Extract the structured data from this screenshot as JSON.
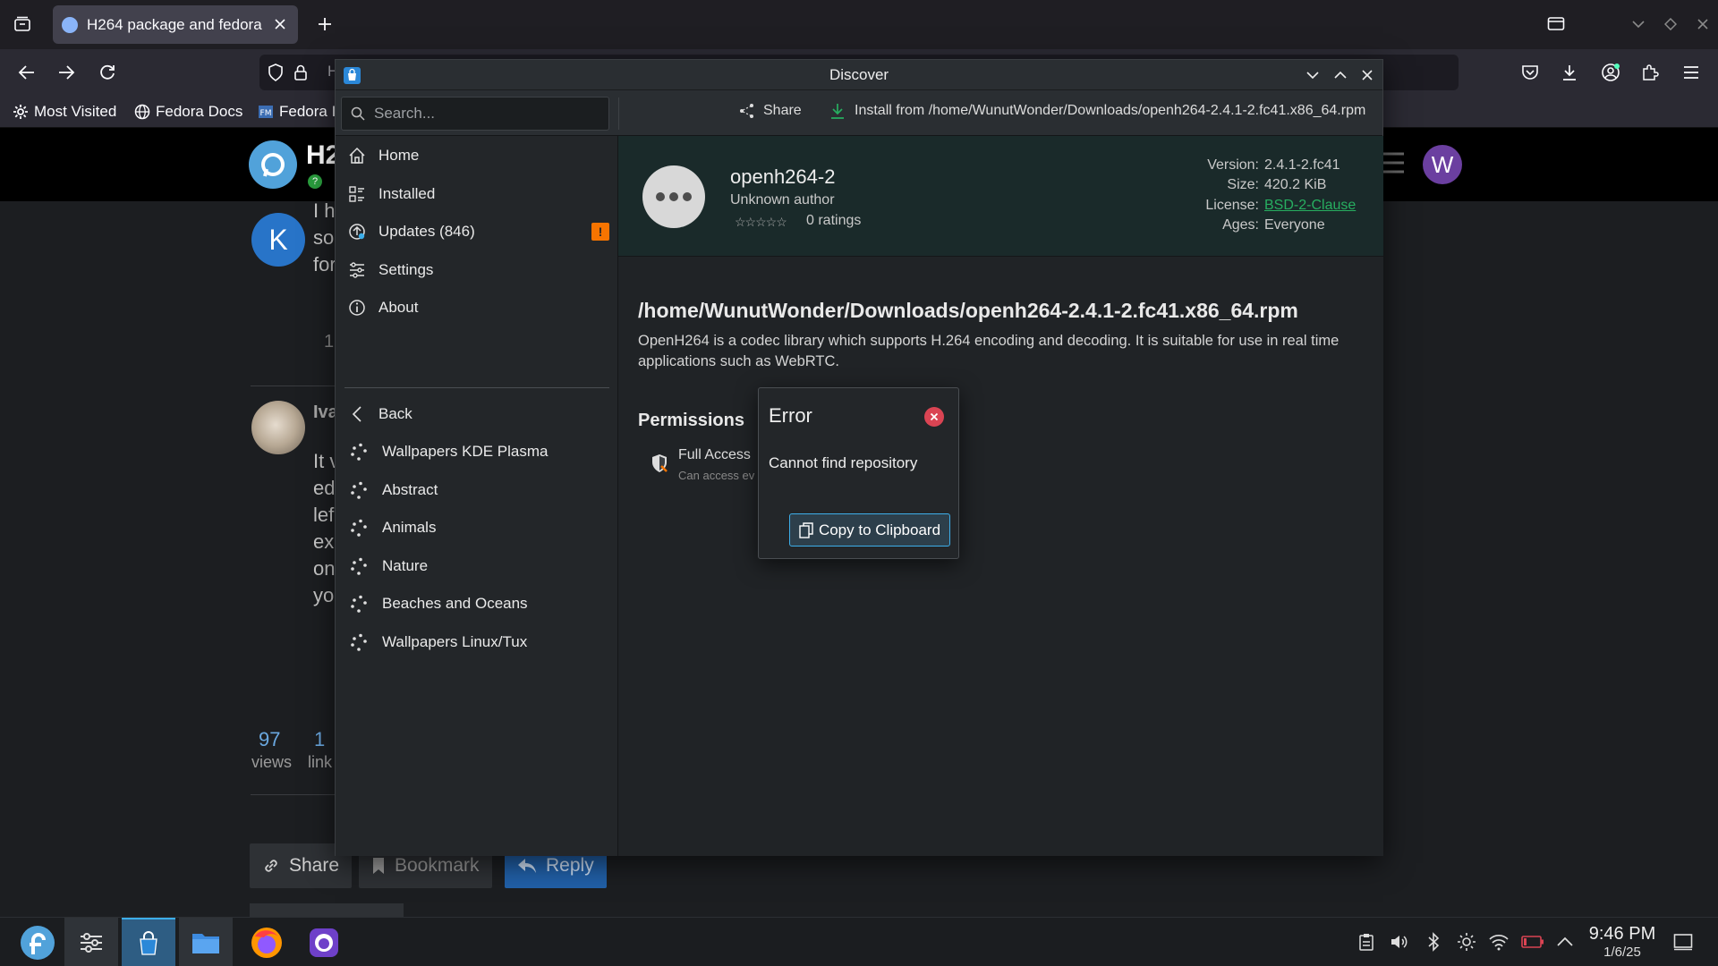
{
  "browser": {
    "tab_title": "H264 package and fedora",
    "url_partial": "H",
    "bookmarks": [
      "Most Visited",
      "Fedora Docs",
      "Fedora I"
    ]
  },
  "webpage": {
    "title_partial": "H2",
    "post1_avatar_letter": "K",
    "post1_lines": [
      "I h",
      "so",
      "for"
    ],
    "post1_counter": "1",
    "post2_author_partial": "Iva",
    "post2_lines": [
      "It v",
      "ed",
      "lef",
      "ex",
      "on",
      "yo"
    ],
    "stats": [
      {
        "num": "97",
        "label": "views"
      },
      {
        "num": "1",
        "label": "link"
      }
    ],
    "buttons": {
      "share": "Share",
      "bookmark": "Bookmark",
      "reply": "Reply"
    },
    "user_avatar_letter": "W"
  },
  "discover": {
    "window_title": "Discover",
    "search_placeholder": "Search...",
    "share_label": "Share",
    "install_label": "Install from /home/WunutWonder/Downloads/openh264-2.4.1-2.fc41.x86_64.rpm",
    "sidebar": {
      "nav": [
        {
          "label": "Home",
          "icon": "home-icon"
        },
        {
          "label": "Installed",
          "icon": "installed-icon"
        },
        {
          "label": "Updates (846)",
          "icon": "updates-icon"
        },
        {
          "label": "Settings",
          "icon": "settings-icon"
        },
        {
          "label": "About",
          "icon": "about-icon"
        }
      ],
      "back": "Back",
      "categories": [
        "Wallpapers KDE Plasma",
        "Abstract",
        "Animals",
        "Nature",
        "Beaches and Oceans",
        "Wallpapers Linux/Tux"
      ]
    },
    "app": {
      "name": "openh264-2",
      "author": "Unknown author",
      "ratings": "0 ratings",
      "version_label": "Version:",
      "version": "2.4.1-2.fc41",
      "size_label": "Size:",
      "size": "420.2 KiB",
      "license_label": "License:",
      "license": "BSD-2-Clause",
      "ages_label": "Ages:",
      "ages": "Everyone",
      "path": "/home/WunutWonder/Downloads/openh264-2.4.1-2.fc41.x86_64.rpm",
      "description": "OpenH264 is a codec library which supports H.264 encoding and decoding. It is suitable for use in real time applications such as WebRTC.",
      "permissions_heading": "Permissions",
      "permission_name": "Full Access",
      "permission_desc_partial": "Can access ev"
    },
    "error": {
      "title": "Error",
      "message": "Cannot find repository",
      "copy_button": "Copy to Clipboard"
    }
  },
  "taskbar": {
    "time": "9:46 PM",
    "date": "1/6/25"
  },
  "colors": {
    "accent": "#3daee9",
    "error_red": "#da4453",
    "update_badge": "#f67400",
    "reply_blue": "#2160a8",
    "link_green": "#27ae60"
  }
}
